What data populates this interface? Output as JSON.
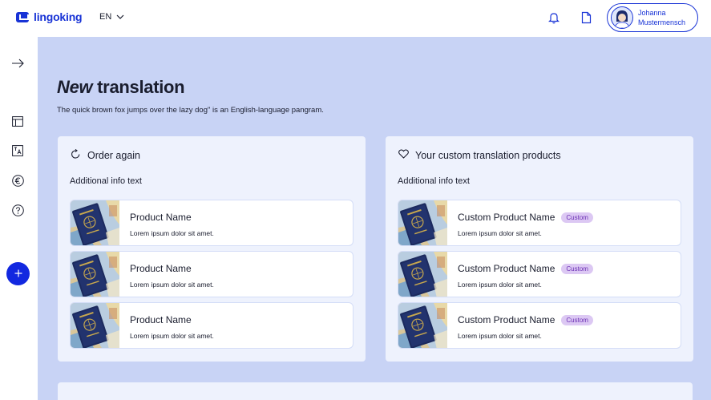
{
  "brand": {
    "name": "lingoking",
    "color": "#1833d6"
  },
  "header": {
    "language": "EN",
    "icons": [
      "bell-icon",
      "document-icon"
    ],
    "user": {
      "first_name": "Johanna",
      "last_name": "Mustermensch"
    }
  },
  "sidebar": {
    "items": [
      "arrow-right-icon",
      "layout-icon",
      "translate-icon",
      "euro-icon",
      "help-icon"
    ],
    "fab_icon": "plus-icon",
    "fab_color": "#1228e0"
  },
  "page": {
    "title_italic": "New",
    "title_rest": " translation",
    "description": "The quick brown fox jumps over the lazy dog\" is an English-language pangram."
  },
  "order_again": {
    "title": "Order again",
    "info": "Additional info text",
    "products": [
      {
        "name": "Product Name",
        "desc": "Lorem ipsum dolor sit amet."
      },
      {
        "name": "Product Name",
        "desc": "Lorem ipsum dolor sit amet."
      },
      {
        "name": "Product Name",
        "desc": "Lorem ipsum dolor sit amet."
      }
    ]
  },
  "custom": {
    "title": "Your custom translation products",
    "info": "Additional info text",
    "products": [
      {
        "name": "Custom Product Name",
        "badge": "Custom",
        "desc": "Lorem ipsum dolor sit amet."
      },
      {
        "name": "Custom Product Name",
        "badge": "Custom",
        "desc": "Lorem ipsum dolor sit amet."
      },
      {
        "name": "Custom Product Name",
        "badge": "Custom",
        "desc": "Lorem ipsum dolor sit amet."
      }
    ]
  },
  "colors": {
    "main_bg": "#c8d3f5",
    "panel_bg": "#eef2fd",
    "badge_bg": "#dcc8f3",
    "badge_text": "#6b2fb4"
  }
}
